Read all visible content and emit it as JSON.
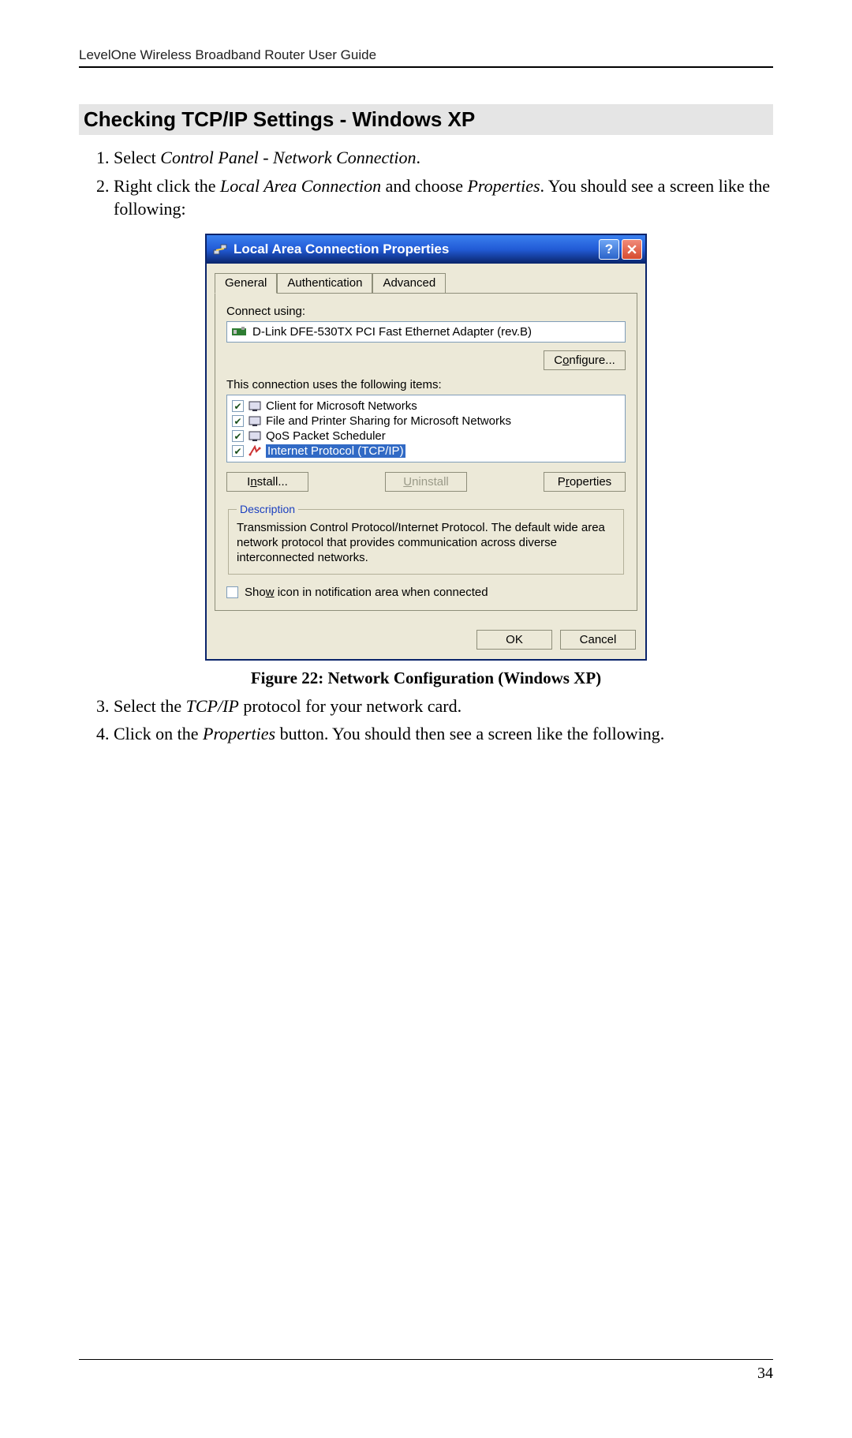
{
  "header": "LevelOne Wireless Broadband Router User Guide",
  "section_title": "Checking TCP/IP Settings - Windows XP",
  "steps_top": {
    "s1_a": "Select ",
    "s1_b": "Control Panel - Network Connection",
    "s1_c": ".",
    "s2_a": "Right click the ",
    "s2_b": "Local Area Connection",
    "s2_c": " and choose ",
    "s2_d": "Properties",
    "s2_e": ". You should see a screen like the following:"
  },
  "dialog": {
    "title": "Local Area Connection Properties",
    "tabs": {
      "general": "General",
      "auth": "Authentication",
      "adv": "Advanced"
    },
    "connect_using_label": "Connect using:",
    "adapter": "D-Link DFE-530TX PCI Fast Ethernet Adapter (rev.B)",
    "configure_pre": "C",
    "configure_u": "o",
    "configure_post": "nfigure...",
    "items_label": "This connection uses the following items:",
    "items": [
      {
        "text": "Client for Microsoft Networks",
        "checked": true,
        "selected": false
      },
      {
        "text": "File and Printer Sharing for Microsoft Networks",
        "checked": true,
        "selected": false
      },
      {
        "text": "QoS Packet Scheduler",
        "checked": true,
        "selected": false
      },
      {
        "text": "Internet Protocol (TCP/IP)",
        "checked": true,
        "selected": true
      }
    ],
    "install_pre": "I",
    "install_u": "n",
    "install_post": "stall...",
    "uninstall_u": "U",
    "uninstall_post": "ninstall",
    "properties_pre": "P",
    "properties_u": "r",
    "properties_post": "operties",
    "desc_legend": "Description",
    "desc_text": "Transmission Control Protocol/Internet Protocol. The default wide area network protocol that provides communication across diverse interconnected networks.",
    "show_icon_pre": "Sho",
    "show_icon_u": "w",
    "show_icon_post": " icon in notification area when connected",
    "ok": "OK",
    "cancel": "Cancel"
  },
  "figure_caption": "Figure 22: Network Configuration (Windows  XP)",
  "steps_bottom": {
    "s3_a": "Select the ",
    "s3_b": "TCP/IP",
    "s3_c": " protocol for your network card.",
    "s4_a": "Click on the ",
    "s4_b": "Properties",
    "s4_c": " button. You should then see a screen like the following."
  },
  "page_number": "34"
}
